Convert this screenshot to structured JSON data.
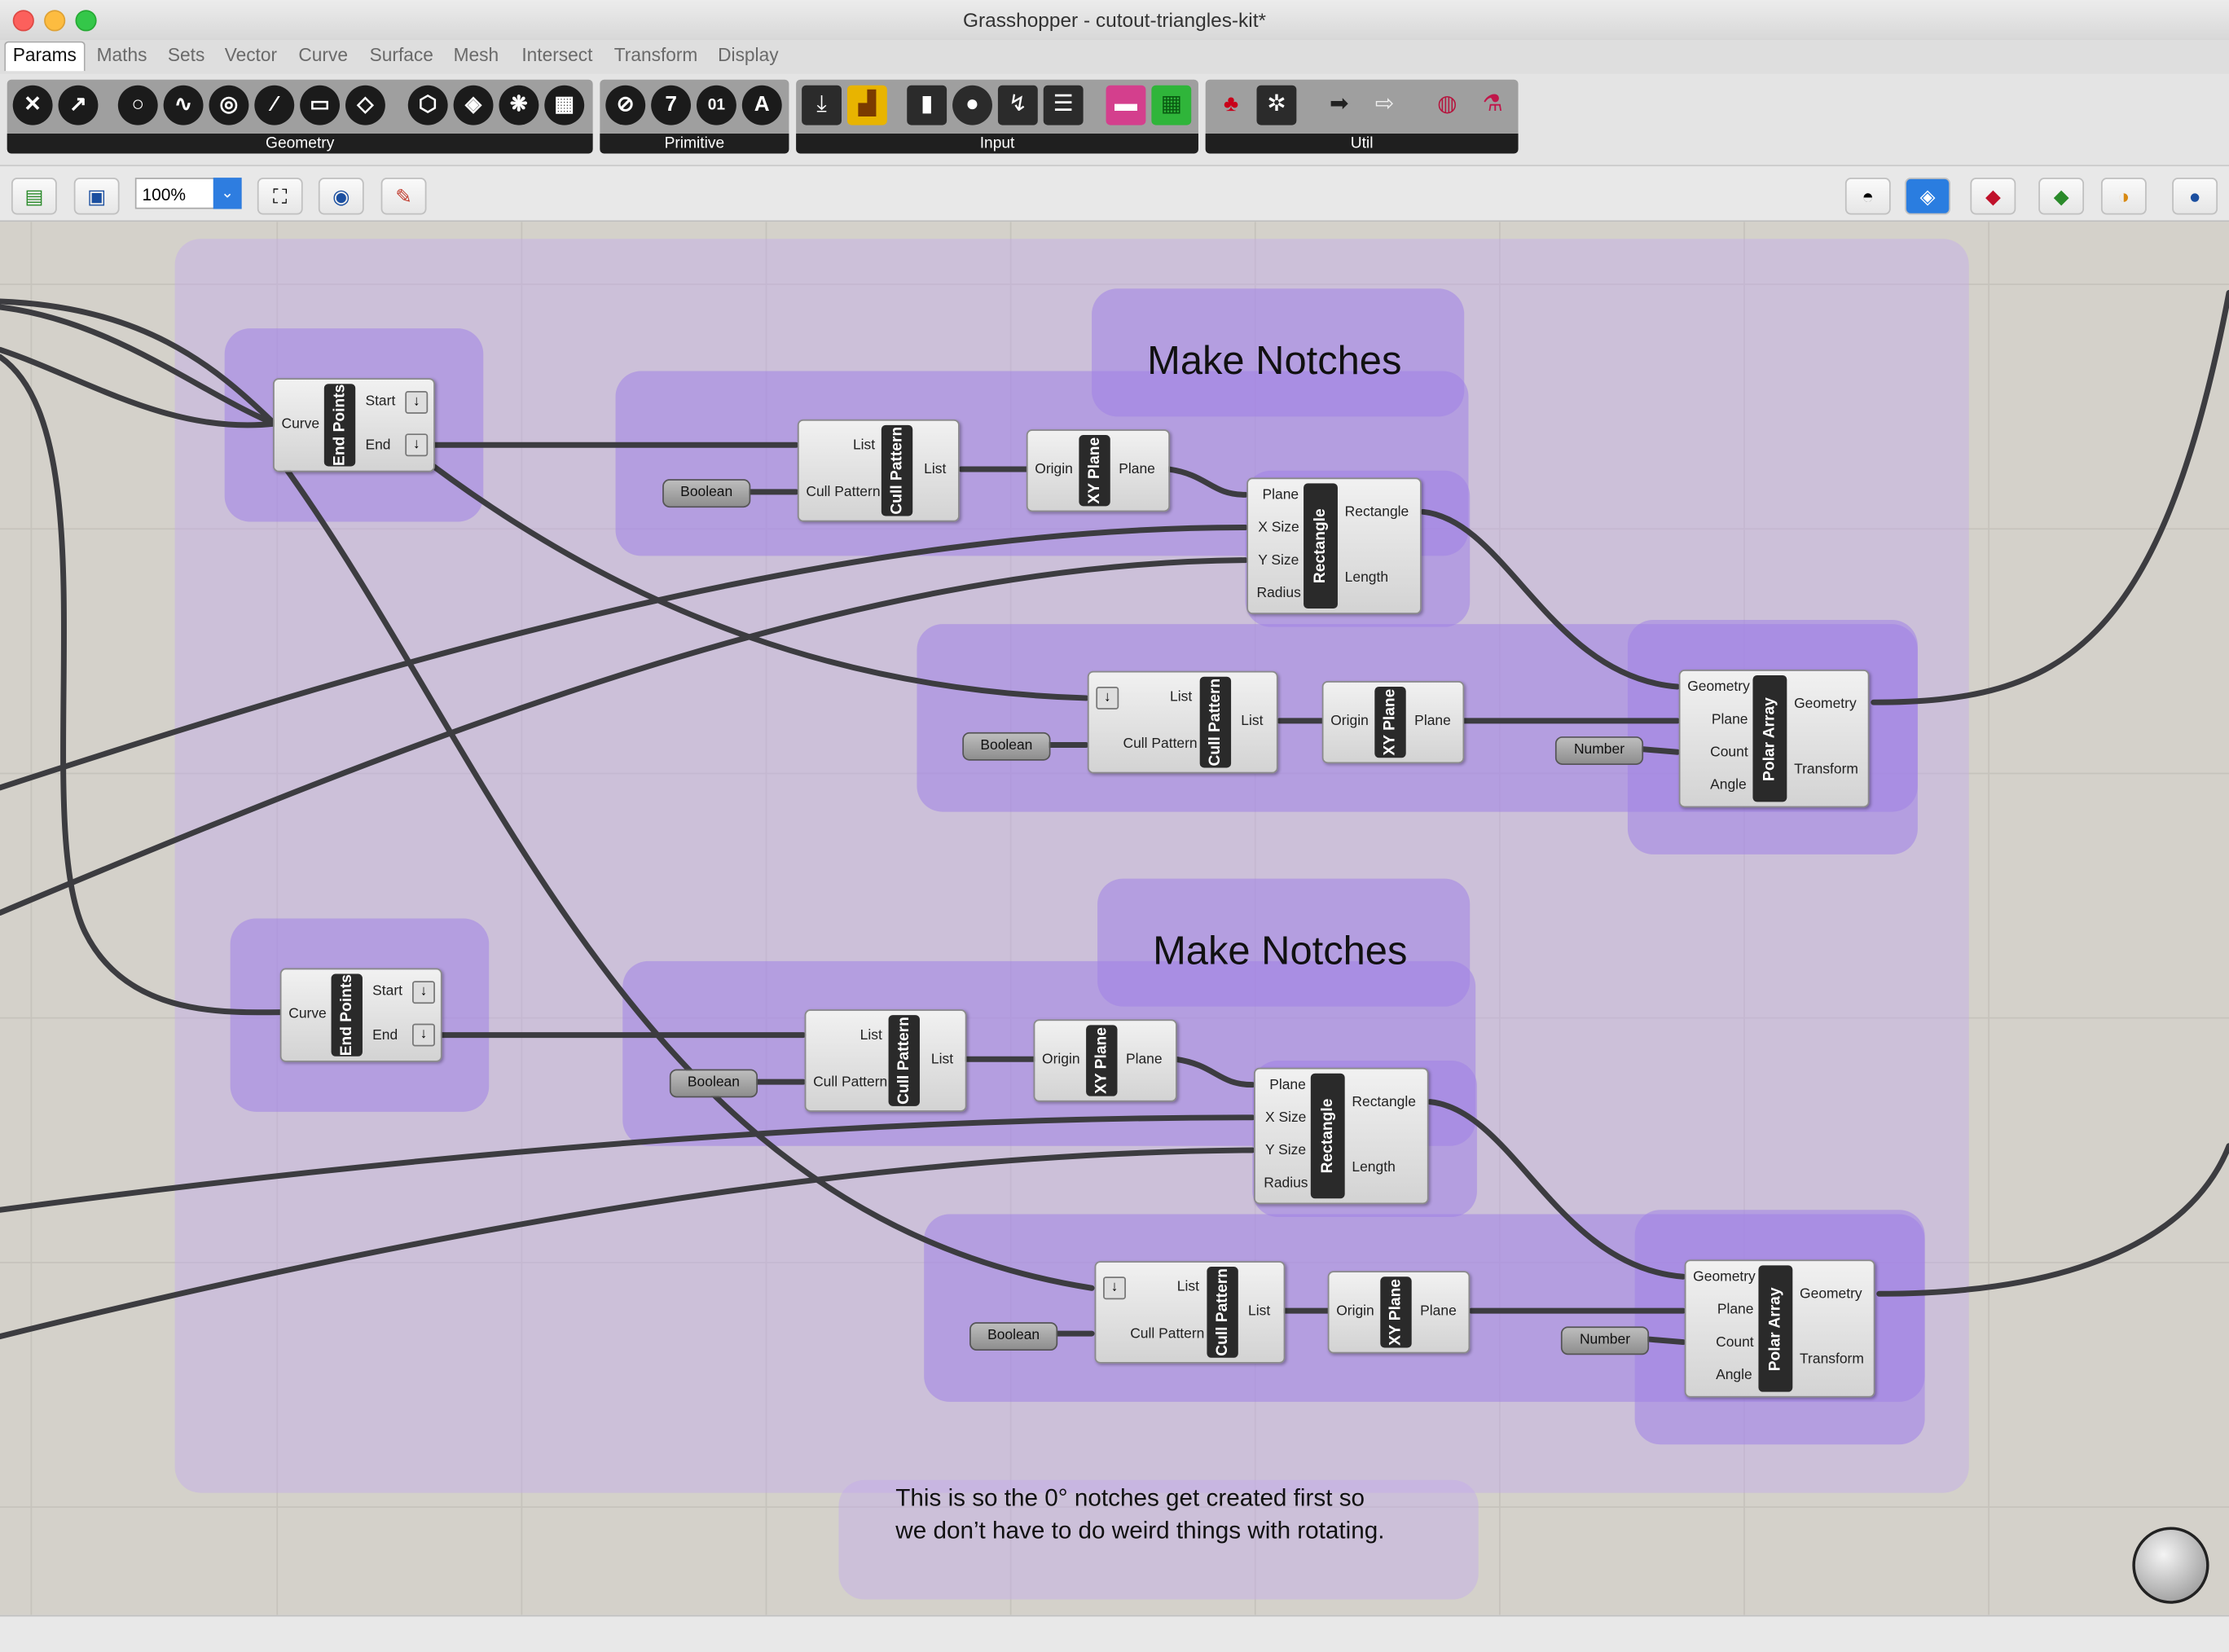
{
  "window": {
    "title": "Grasshopper - cutout-triangles-kit*"
  },
  "menu_tabs": [
    "Params",
    "Maths",
    "Sets",
    "Vector",
    "Curve",
    "Surface",
    "Mesh",
    "Intersect",
    "Transform",
    "Display"
  ],
  "ribbon_groups": [
    "Geometry",
    "Primitive",
    "Input",
    "Util"
  ],
  "primitive_glyphs": [
    "7",
    "01",
    "A"
  ],
  "toolbar": {
    "zoom": "100%"
  },
  "groups": {
    "make_notches_1": "Make Notches",
    "make_notches_2": "Make Notches"
  },
  "note": {
    "line1": "This is so the 0° notches get created first so",
    "line2": "we don’t have to do weird things with rotating."
  },
  "components": {
    "end_points": {
      "name": "End Points",
      "in": [
        "Curve"
      ],
      "out": [
        "Start",
        "End"
      ]
    },
    "cull_pattern": {
      "name": "Cull Pattern",
      "in": [
        "List",
        "Cull Pattern"
      ],
      "out": [
        "List"
      ]
    },
    "xy_plane": {
      "name": "XY Plane",
      "in": [
        "Origin"
      ],
      "out": [
        "Plane"
      ]
    },
    "rectangle": {
      "name": "Rectangle",
      "in": [
        "Plane",
        "X Size",
        "Y Size",
        "Radius"
      ],
      "out": [
        "Rectangle",
        "Length"
      ]
    },
    "polar_array": {
      "name": "Polar Array",
      "in": [
        "Geometry",
        "Plane",
        "Count",
        "Angle"
      ],
      "out": [
        "Geometry",
        "Transform"
      ]
    },
    "boolean": "Boolean",
    "number": "Number"
  },
  "colors": {
    "canvas": "#d4d1ca",
    "group": "#a082e6",
    "wire": "#3c3c40"
  }
}
